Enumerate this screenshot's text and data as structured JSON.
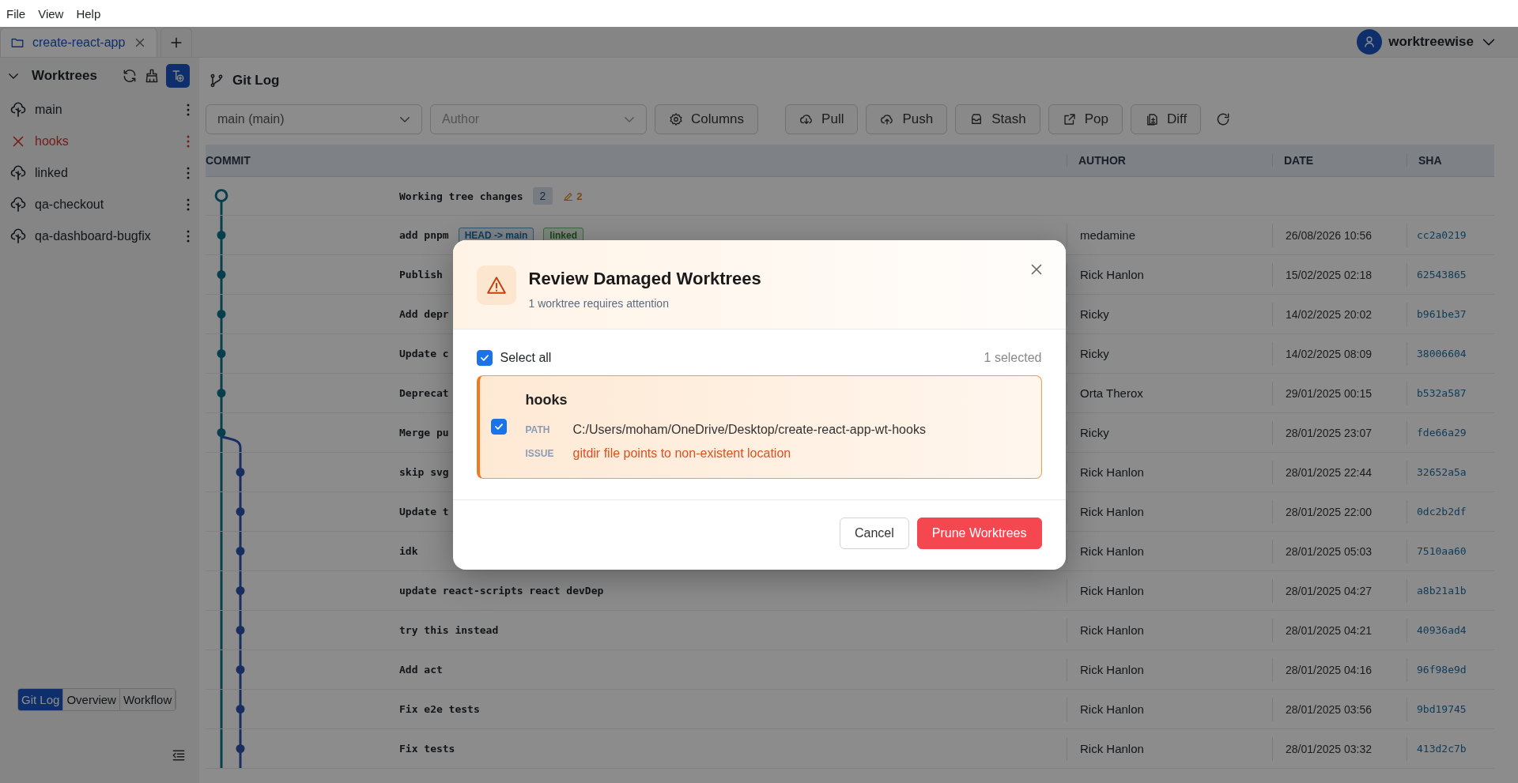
{
  "menu": [
    "File",
    "View",
    "Help"
  ],
  "tabs": [
    {
      "label": "create-react-app",
      "selected": true
    }
  ],
  "user": {
    "name": "worktreewise"
  },
  "sidebar": {
    "title": "Worktrees",
    "worktrees": [
      {
        "name": "main",
        "damaged": false
      },
      {
        "name": "hooks",
        "damaged": true
      },
      {
        "name": "linked",
        "damaged": false
      },
      {
        "name": "qa-checkout",
        "damaged": false
      },
      {
        "name": "qa-dashboard-bugfix",
        "damaged": false
      }
    ],
    "views": [
      {
        "label": "Git Log",
        "selected": true
      },
      {
        "label": "Overview",
        "selected": false
      },
      {
        "label": "Workflow",
        "selected": false
      }
    ]
  },
  "git_log": {
    "title": "Git Log",
    "branch_filter": {
      "value": "main (main)"
    },
    "author_filter": {
      "placeholder": "Author"
    },
    "buttons": [
      "Columns",
      "Pull",
      "Push",
      "Stash",
      "Pop",
      "Diff"
    ],
    "columns": [
      "COMMIT",
      "AUTHOR",
      "DATE",
      "SHA"
    ],
    "rows": [
      {
        "kind": "working",
        "message": "Working tree changes",
        "count": "2",
        "changes": "2"
      },
      {
        "kind": "main",
        "message": "add pnpm",
        "refs": [
          {
            "label": "HEAD -> main",
            "kind": "head"
          },
          {
            "label": "linked",
            "kind": "worktree"
          }
        ],
        "author": "medamine",
        "date": "26/08/2026 10:56",
        "sha": "cc2a0219"
      },
      {
        "kind": "main",
        "message": "Publish",
        "author": "Rick Hanlon",
        "date": "15/02/2025 02:18",
        "sha": "62543865"
      },
      {
        "kind": "main",
        "message": "Add depr",
        "author": "Ricky",
        "date": "14/02/2025 20:02",
        "sha": "b961be37"
      },
      {
        "kind": "main",
        "message": "Update c",
        "author": "Ricky",
        "date": "14/02/2025 08:09",
        "sha": "38006604"
      },
      {
        "kind": "main",
        "message": "Deprecat",
        "author": "Orta Therox",
        "date": "29/01/2025 00:15",
        "sha": "b532a587"
      },
      {
        "kind": "merge",
        "message": "Merge pu",
        "author": "Ricky",
        "date": "28/01/2025 23:07",
        "sha": "fde66a29"
      },
      {
        "kind": "branch",
        "message": "skip svg",
        "author": "Rick Hanlon",
        "date": "28/01/2025 22:44",
        "sha": "32652a5a"
      },
      {
        "kind": "branch",
        "message": "Update t",
        "author": "Rick Hanlon",
        "date": "28/01/2025 22:00",
        "sha": "0dc2b2df"
      },
      {
        "kind": "branch",
        "message": "idk",
        "author": "Rick Hanlon",
        "date": "28/01/2025 05:03",
        "sha": "7510aa60"
      },
      {
        "kind": "branch",
        "message": "update react-scripts react devDep",
        "author": "Rick Hanlon",
        "date": "28/01/2025 04:27",
        "sha": "a8b21a1b"
      },
      {
        "kind": "branch",
        "message": "try this instead",
        "author": "Rick Hanlon",
        "date": "28/01/2025 04:21",
        "sha": "40936ad4"
      },
      {
        "kind": "branch",
        "message": "Add act",
        "author": "Rick Hanlon",
        "date": "28/01/2025 04:16",
        "sha": "96f98e9d"
      },
      {
        "kind": "branch",
        "message": "Fix e2e tests",
        "author": "Rick Hanlon",
        "date": "28/01/2025 03:56",
        "sha": "9bd19745"
      },
      {
        "kind": "branch",
        "message": "Fix tests",
        "author": "Rick Hanlon",
        "date": "28/01/2025 03:32",
        "sha": "413d2c7b"
      }
    ]
  },
  "dialog": {
    "title": "Review Damaged Worktrees",
    "subtitle": "1 worktree requires attention",
    "select_all": {
      "label": "Select all",
      "checked": true
    },
    "selected_count": "1 selected",
    "items": [
      {
        "name": "hooks",
        "checked": true,
        "path_label": "PATH",
        "path": "C:/Users/moham/OneDrive/Desktop/create-react-app-wt-hooks",
        "issue_label": "ISSUE",
        "issue": "gitdir file points to non-existent location"
      }
    ],
    "buttons": [
      "Cancel",
      "Prune Worktrees"
    ]
  }
}
